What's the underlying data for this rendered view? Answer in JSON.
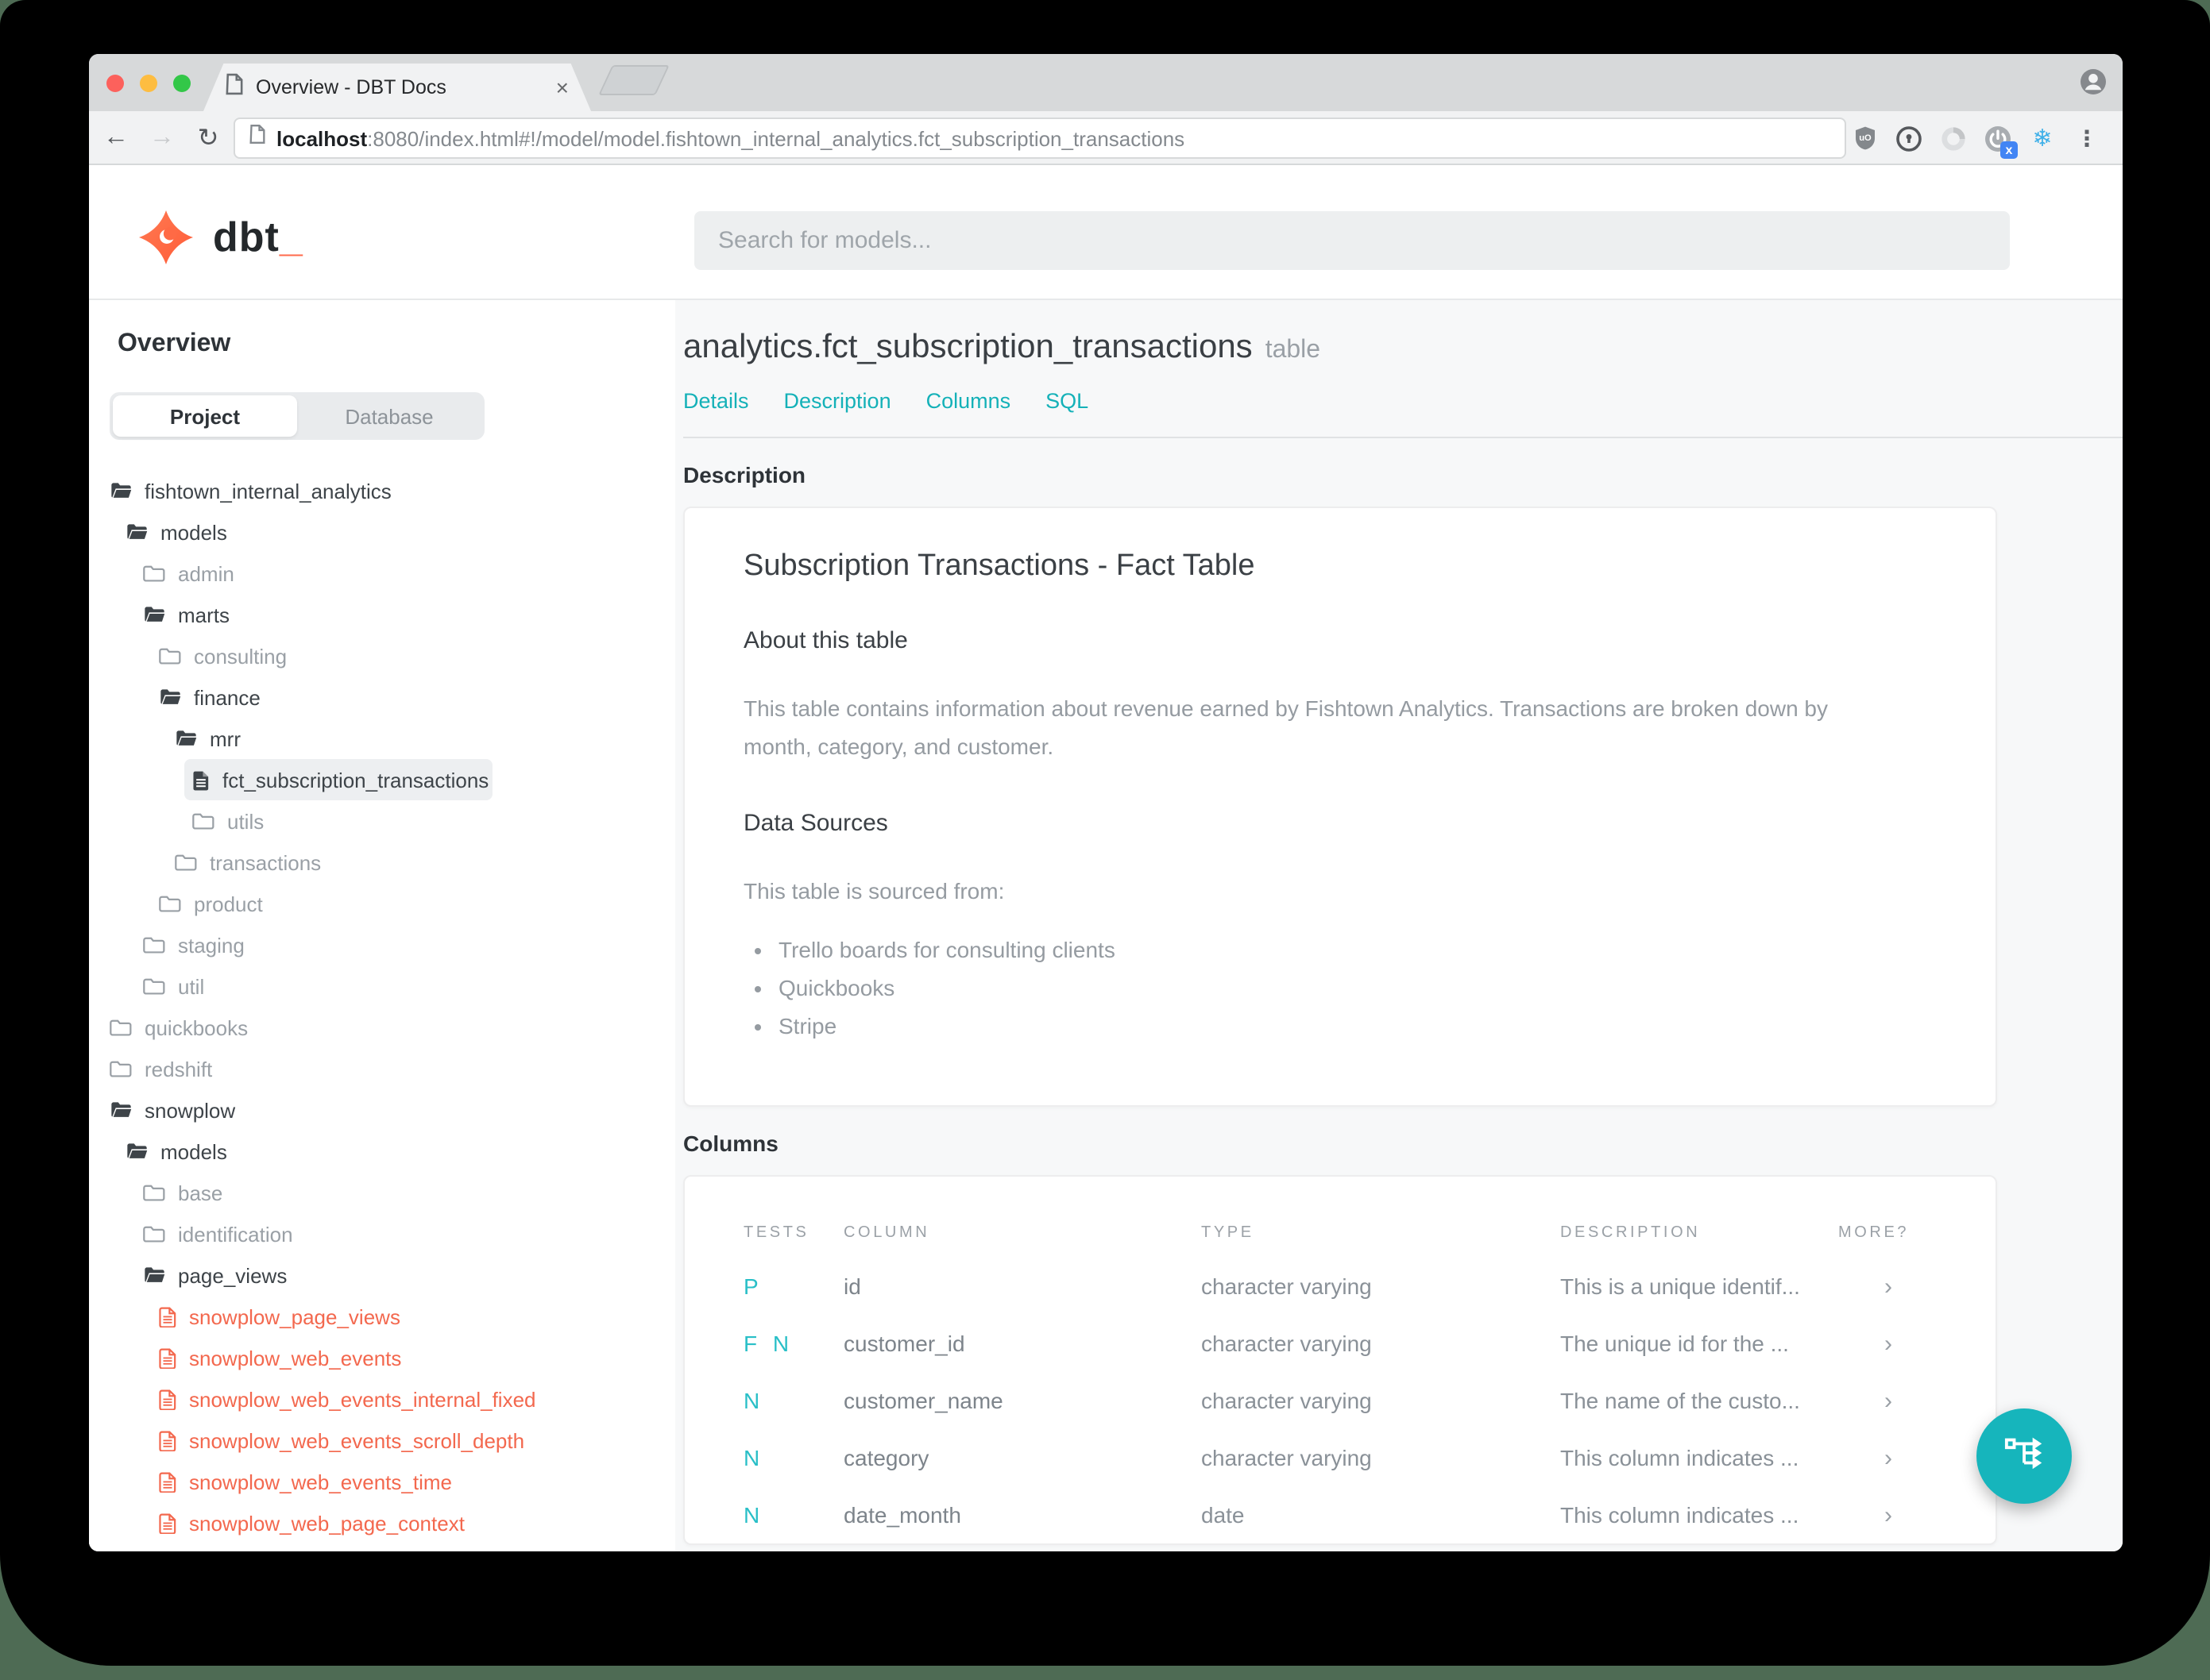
{
  "browser": {
    "tab_title": "Overview - DBT Docs",
    "close_tab": "×",
    "url_host": "localhost",
    "url_rest": ":8080/index.html#!/model/model.fishtown_internal_analytics.fct_subscription_transactions",
    "back": "←",
    "forward": "→",
    "reload": "↻",
    "menu_dots": "⋮",
    "snowflake": "❄",
    "ext_badge_x": "x",
    "extension_icons": [
      "ublock-origin-icon",
      "onepassword-icon",
      "extension-circle-icon",
      "power-x-icon",
      "snowflake-icon",
      "menu-icon"
    ]
  },
  "header": {
    "logo_text": "dbt",
    "logo_cursor": "_",
    "search_placeholder": "Search for models..."
  },
  "sidebar": {
    "title": "Overview",
    "tabs": [
      {
        "label": "Project",
        "active": true
      },
      {
        "label": "Database",
        "active": false
      }
    ],
    "tree": [
      {
        "label": "fishtown_internal_analytics",
        "level": 0,
        "icon": "folder-open"
      },
      {
        "label": "models",
        "level": 1,
        "icon": "folder-open"
      },
      {
        "label": "admin",
        "level": 2,
        "icon": "folder-closed"
      },
      {
        "label": "marts",
        "level": 2,
        "icon": "folder-open"
      },
      {
        "label": "consulting",
        "level": 3,
        "icon": "folder-closed"
      },
      {
        "label": "finance",
        "level": 3,
        "icon": "folder-open"
      },
      {
        "label": "mrr",
        "level": 4,
        "icon": "folder-open"
      },
      {
        "label": "fct_subscription_transactions",
        "level": 5,
        "icon": "file",
        "selected": true
      },
      {
        "label": "utils",
        "level": 5,
        "icon": "folder-closed"
      },
      {
        "label": "transactions",
        "level": 4,
        "icon": "folder-closed"
      },
      {
        "label": "product",
        "level": 3,
        "icon": "folder-closed"
      },
      {
        "label": "staging",
        "level": 2,
        "icon": "folder-closed"
      },
      {
        "label": "util",
        "level": 2,
        "icon": "folder-closed"
      },
      {
        "label": "quickbooks",
        "level": 0,
        "icon": "folder-closed"
      },
      {
        "label": "redshift",
        "level": 0,
        "icon": "folder-closed"
      },
      {
        "label": "snowplow",
        "level": 0,
        "icon": "folder-open"
      },
      {
        "label": "models",
        "level": 1,
        "icon": "folder-open"
      },
      {
        "label": "base",
        "level": 2,
        "icon": "folder-closed"
      },
      {
        "label": "identification",
        "level": 2,
        "icon": "folder-closed"
      },
      {
        "label": "page_views",
        "level": 2,
        "icon": "folder-open"
      },
      {
        "label": "snowplow_page_views",
        "level": 3,
        "icon": "file-red"
      },
      {
        "label": "snowplow_web_events",
        "level": 3,
        "icon": "file-red"
      },
      {
        "label": "snowplow_web_events_internal_fixed",
        "level": 3,
        "icon": "file-red"
      },
      {
        "label": "snowplow_web_events_scroll_depth",
        "level": 3,
        "icon": "file-red"
      },
      {
        "label": "snowplow_web_events_time",
        "level": 3,
        "icon": "file-red"
      },
      {
        "label": "snowplow_web_page_context",
        "level": 3,
        "icon": "file-red"
      }
    ]
  },
  "main": {
    "title": "analytics.fct_subscription_transactions",
    "title_suffix": "table",
    "nav": [
      "Details",
      "Description",
      "Columns",
      "SQL"
    ],
    "description_label": "Description",
    "doc": {
      "h1": "Subscription Transactions - Fact Table",
      "about_heading": "About this table",
      "about_text": "This table contains information about revenue earned by Fishtown Analytics. Transactions are broken down by month, category, and customer.",
      "sources_heading": "Data Sources",
      "sources_intro": "This table is sourced from:",
      "sources": [
        "Trello boards for consulting clients",
        "Quickbooks",
        "Stripe"
      ]
    },
    "columns_label": "Columns",
    "table": {
      "headers": [
        "TESTS",
        "COLUMN",
        "TYPE",
        "DESCRIPTION",
        "MORE?"
      ],
      "rows": [
        {
          "tests": "P",
          "column": "id",
          "type": "character varying",
          "description": "This is a unique identif...",
          "more": "›"
        },
        {
          "tests": "F N",
          "column": "customer_id",
          "type": "character varying",
          "description": "The unique id for the ...",
          "more": "›"
        },
        {
          "tests": "N",
          "column": "customer_name",
          "type": "character varying",
          "description": "The name of the custo...",
          "more": "›"
        },
        {
          "tests": "N",
          "column": "category",
          "type": "character varying",
          "description": "This column indicates ...",
          "more": "›"
        },
        {
          "tests": "N",
          "column": "date_month",
          "type": "date",
          "description": "This column indicates ...",
          "more": "›"
        }
      ]
    },
    "fab_icon": "lineage-graph-icon"
  },
  "colors": {
    "accent_teal": "#14b1b8",
    "tests_teal": "#29bfc7",
    "fab_teal": "#16b5bc",
    "brand_orange": "#ff6a4b",
    "file_red": "#f3684e",
    "wallpaper_green": "#4e6b54"
  }
}
